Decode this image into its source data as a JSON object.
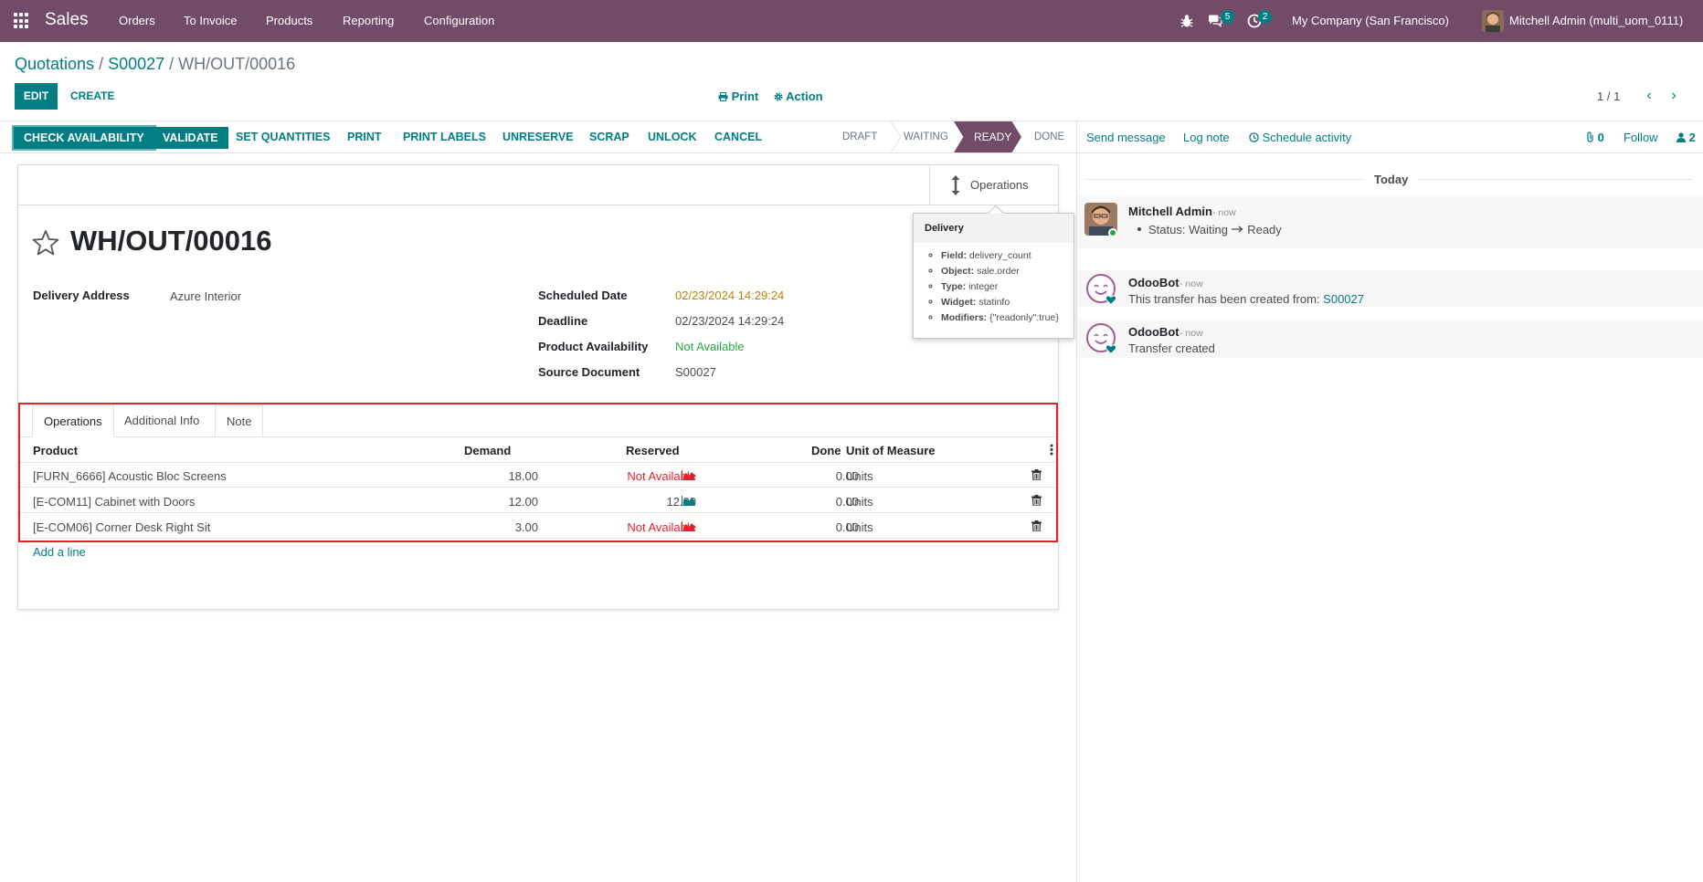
{
  "navbar": {
    "app_name": "Sales",
    "menu": [
      "Orders",
      "To Invoice",
      "Products",
      "Reporting",
      "Configuration"
    ],
    "chat_count": "5",
    "activity_count": "2",
    "company": "My Company (San Francisco)",
    "user": "Mitchell Admin (multi_uom_0111)"
  },
  "breadcrumb": {
    "root": "Quotations",
    "parent": "S00027",
    "current": "WH/OUT/00016"
  },
  "toolbar": {
    "edit": "EDIT",
    "create": "CREATE",
    "print": "Print",
    "action": "Action"
  },
  "pager": {
    "value": "1 / 1"
  },
  "statusbar": {
    "buttons": [
      "CHECK AVAILABILITY",
      "VALIDATE",
      "SET QUANTITIES",
      "PRINT",
      "PRINT LABELS",
      "UNRESERVE",
      "SCRAP",
      "UNLOCK",
      "CANCEL"
    ],
    "stages": [
      "DRAFT",
      "WAITING",
      "READY",
      "DONE"
    ],
    "active_stage": "READY"
  },
  "form": {
    "stat_button": "Operations",
    "title": "WH/OUT/00016",
    "delivery_address_label": "Delivery Address",
    "delivery_address": "Azure Interior",
    "scheduled_date_label": "Scheduled Date",
    "scheduled_date": "02/23/2024 14:29:24",
    "deadline_label": "Deadline",
    "deadline": "02/23/2024 14:29:24",
    "availability_label": "Product Availability",
    "availability": "Not Available",
    "source_label": "Source Document",
    "source": "S00027"
  },
  "notebook": {
    "tabs": [
      "Operations",
      "Additional Info",
      "Note"
    ],
    "columns": [
      "Product",
      "Demand",
      "Reserved",
      "Done",
      "Unit of Measure"
    ],
    "rows": [
      {
        "product": "[FURN_6666] Acoustic Bloc Screens",
        "demand": "18.00",
        "reserved": "Not Available",
        "done": "0.00",
        "uom": "Units"
      },
      {
        "product": "[E-COM11] Cabinet with Doors",
        "demand": "12.00",
        "reserved": "12.00",
        "done": "0.00",
        "uom": "Units"
      },
      {
        "product": "[E-COM06] Corner Desk Right Sit",
        "demand": "3.00",
        "reserved": "Not Available",
        "done": "0.00",
        "uom": "Units"
      }
    ],
    "add_line": "Add a line"
  },
  "tooltip": {
    "title": "Delivery",
    "items": [
      {
        "key": "Field:",
        "value": "delivery_count"
      },
      {
        "key": "Object:",
        "value": "sale.order"
      },
      {
        "key": "Type:",
        "value": "integer"
      },
      {
        "key": "Widget:",
        "value": "statinfo"
      },
      {
        "key": "Modifiers:",
        "value": "{\"readonly\":true}"
      }
    ]
  },
  "chatter": {
    "send_message": "Send message",
    "log_note": "Log note",
    "schedule_activity": "Schedule activity",
    "attachments": "0",
    "follow": "Follow",
    "followers": "2",
    "today": "Today",
    "messages": [
      {
        "author": "Mitchell Admin",
        "when": "- now",
        "body_prefix": "Status: Waiting",
        "body_suffix": "Ready"
      },
      {
        "author": "OdooBot",
        "when": "- now",
        "body_prefix": "This transfer has been created from:",
        "link": "S00027"
      },
      {
        "author": "OdooBot",
        "when": "- now",
        "body_prefix": "Transfer created"
      }
    ]
  },
  "colors": {
    "brand": "#714b67",
    "primary": "#017e84",
    "danger": "#e0242b",
    "success": "#28a745",
    "warning": "#b8860b"
  }
}
